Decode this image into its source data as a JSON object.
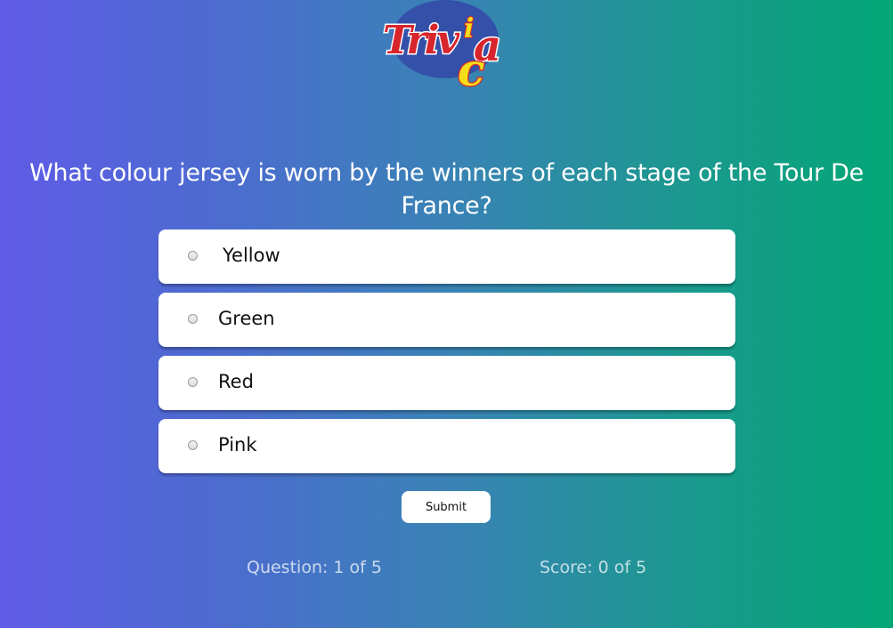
{
  "logo": {
    "text": "Trivia",
    "colors": {
      "oval": "#3450a8",
      "letters": "#d8252c",
      "accent_letters": "#f6dd1c",
      "outline": "#ffffff"
    }
  },
  "quiz": {
    "question": "What colour jersey is worn by the winners of each stage of the Tour De France?",
    "options": [
      {
        "label": "Yellow",
        "selected": false
      },
      {
        "label": "Green",
        "selected": false
      },
      {
        "label": "Red",
        "selected": false
      },
      {
        "label": "Pink",
        "selected": false
      }
    ],
    "submit_label": "Submit"
  },
  "footer": {
    "question_progress": "Question: 1 of 5",
    "score": "Score: 0 of 5"
  },
  "colors": {
    "gradient_start": "#5f5be6",
    "gradient_end": "#03a776",
    "card": "#ffffff"
  }
}
